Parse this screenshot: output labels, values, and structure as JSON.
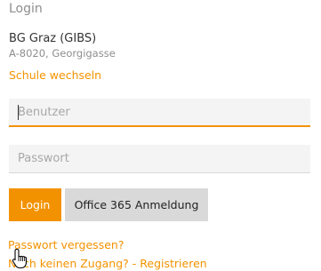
{
  "login": {
    "heading": "Login",
    "school": {
      "name": "BG Graz (GIBS)",
      "address": "A-8020, Georgigasse"
    },
    "change_school_link": "Schule wechseln",
    "username_placeholder": "Benutzer",
    "password_placeholder": "Passwort",
    "login_button": "Login",
    "office365_button": "Office 365 Anmeldung",
    "forgot_password_link": "Passwort vergessen?",
    "register_link": "Noch keinen Zugang? - Registrieren"
  },
  "colors": {
    "accent": "#f39200",
    "muted_text": "#8e8e8e",
    "field_background": "#f4f4f4",
    "secondary_button": "#d9d9d9"
  },
  "icons": {
    "mouse_cursor": "hand-pointer-icon"
  }
}
